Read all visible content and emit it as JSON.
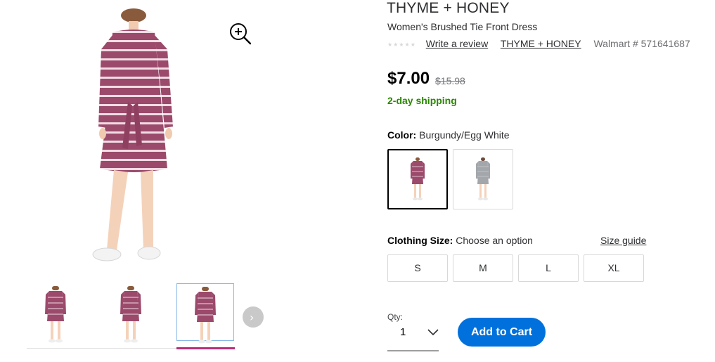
{
  "product": {
    "brand": "THYME + HONEY",
    "name": "Women's Brushed Tie Front Dress",
    "rating_stars": "★★★★★",
    "write_review": "Write a review",
    "brand_link": "THYME + HONEY",
    "walmart_number": "Walmart # 571641687",
    "price": "$7.00",
    "was_price": "$15.98",
    "shipping": "2-day shipping"
  },
  "color": {
    "label": "Color:",
    "selected_value": "Burgundy/Egg White",
    "swatches": [
      "Burgundy/Egg White",
      "Gray"
    ]
  },
  "size": {
    "label": "Clothing Size:",
    "placeholder": "Choose an option",
    "guide": "Size guide",
    "options": [
      "S",
      "M",
      "L",
      "XL"
    ]
  },
  "quantity": {
    "label": "Qty:",
    "value": "1"
  },
  "cart": {
    "add_label": "Add to Cart"
  },
  "gallery": {
    "selected_thumb_index": 2,
    "thumb_count": 3
  },
  "colors": {
    "dress_burgundy": "#9b4a6b",
    "stripe": "#f1dce4",
    "dress_gray": "#a3a7ab",
    "accent_blue": "#0071dc",
    "shipping_green": "#2a8703",
    "thumb_active_bar": "#b72c79"
  },
  "icons": {
    "zoom": "zoom-in-icon",
    "next": "chevron-right-icon",
    "qty": "chevron-down-icon"
  }
}
